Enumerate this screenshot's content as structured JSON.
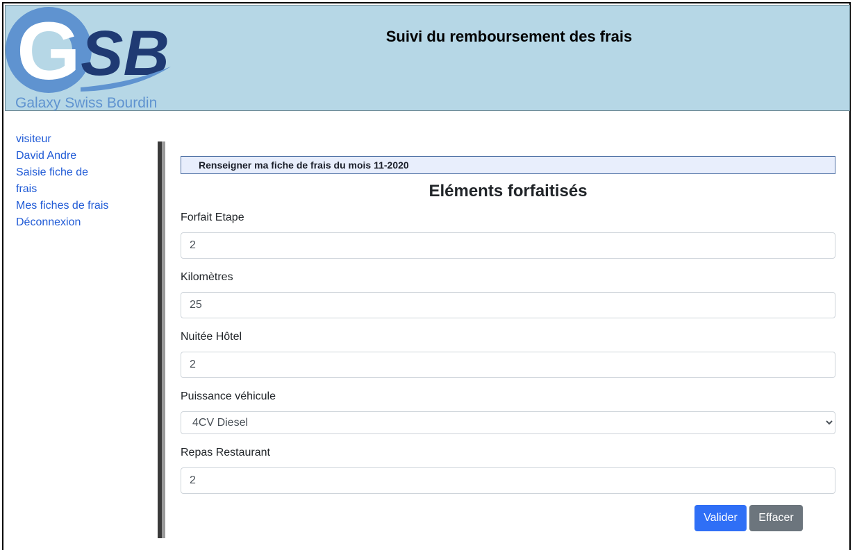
{
  "header": {
    "title": "Suivi du remboursement des frais",
    "logo": {
      "initials_g": "G",
      "initials_sb": "SB",
      "company": "Galaxy Swiss Bourdin"
    }
  },
  "sidebar": {
    "items": [
      {
        "label": "visiteur"
      },
      {
        "label": "David Andre"
      },
      {
        "label": "Saisie fiche de"
      },
      {
        "label": "frais"
      },
      {
        "label": "Mes fiches de frais"
      },
      {
        "label": "Déconnexion"
      }
    ]
  },
  "main": {
    "banner": "Renseigner ma fiche de frais du mois 11-2020",
    "section_title": "Eléments forfaitisés",
    "fields": [
      {
        "label": "Forfait Etape",
        "value": "2"
      },
      {
        "label": "Kilomètres",
        "value": "25"
      },
      {
        "label": "Nuitée Hôtel",
        "value": "2"
      },
      {
        "label": "Puissance véhicule",
        "value": "4CV Diesel"
      },
      {
        "label": "Repas Restaurant",
        "value": "2"
      }
    ],
    "buttons": {
      "submit": "Valider",
      "reset": "Effacer"
    }
  },
  "colors": {
    "header_bg": "#b6d7e6",
    "link": "#1f5ad6",
    "primary_button": "#2f6ff6",
    "secondary_button": "#6c757d",
    "logo_light_blue": "#5f93d0",
    "logo_dark_blue": "#1f3a73"
  }
}
